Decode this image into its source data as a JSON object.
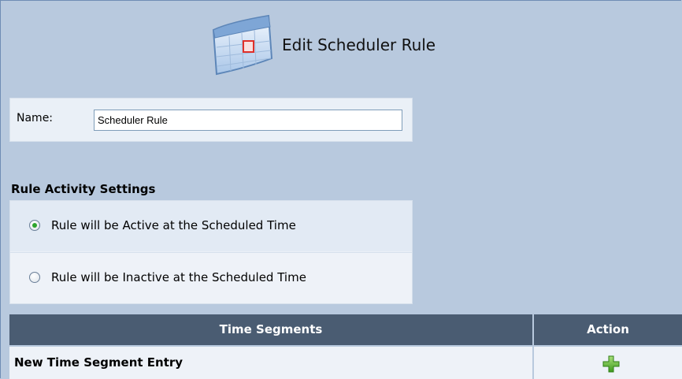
{
  "header": {
    "title": "Edit Scheduler Rule",
    "icon": "calendar-icon"
  },
  "name_field": {
    "label": "Name:",
    "value": "Scheduler Rule"
  },
  "activity": {
    "title": "Rule Activity Settings",
    "options": [
      {
        "label": "Rule will be Active at the Scheduled Time",
        "selected": true
      },
      {
        "label": "Rule will be Inactive at the Scheduled Time",
        "selected": false
      }
    ]
  },
  "table": {
    "columns": [
      "Time Segments",
      "Action"
    ],
    "rows": [
      {
        "label": "New Time Segment Entry",
        "action_icon": "add-icon"
      }
    ]
  },
  "colors": {
    "background": "#b8c9de",
    "header_row": "#4a5c72",
    "radio_selected": "#2da52d",
    "add_icon": "#4fae2a"
  }
}
